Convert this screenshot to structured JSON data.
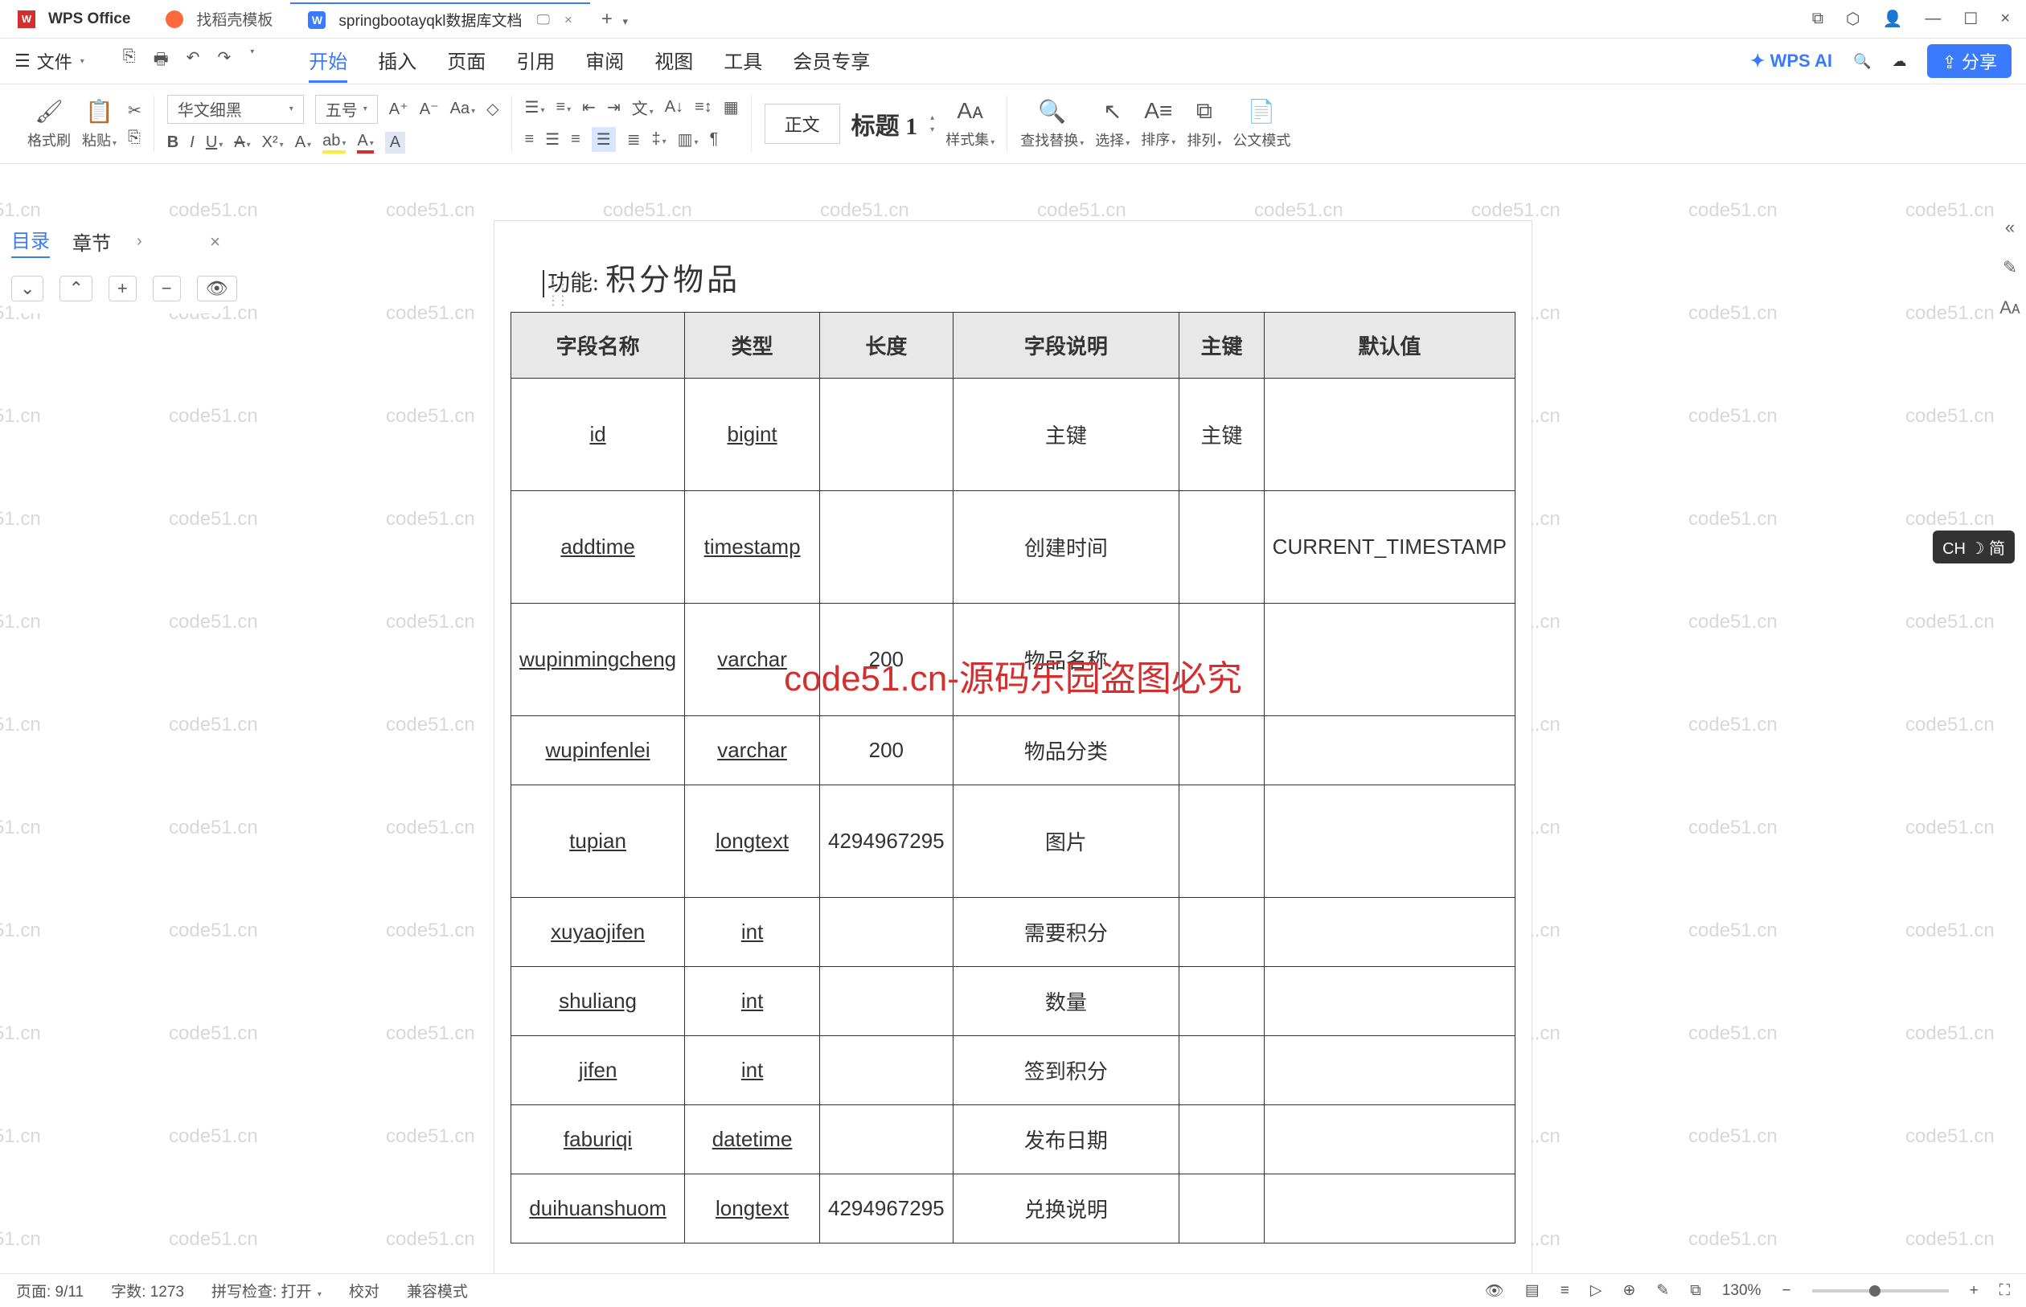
{
  "titlebar": {
    "app": "WPS Office",
    "tab2": "找稻壳模板",
    "tab3": "springbootayqkl数据库文档",
    "close": "×",
    "plus": "+",
    "caret": "▾"
  },
  "winctrl": {
    "min": "—",
    "max": "☐",
    "close": "×"
  },
  "quickaccess": [
    "⎘",
    "🖶",
    "⎌",
    "⎌"
  ],
  "fileitem": "文件",
  "menus": {
    "start": "开始",
    "insert": "插入",
    "page": "页面",
    "ref": "引用",
    "review": "审阅",
    "view": "视图",
    "tools": "工具",
    "member": "会员专享"
  },
  "ai": "WPS AI",
  "share": "分享",
  "toolbar": {
    "format_brush": "格式刷",
    "paste": "粘贴",
    "font_name": "华文细黑",
    "font_size": "五号",
    "style_body": "正文",
    "style_h1": "标题 1",
    "styles": "样式集",
    "findrep": "查找替换",
    "select": "选择",
    "sort": "排序",
    "sort2": "排列",
    "official": "公文模式"
  },
  "sidenav": {
    "tab1": "目录",
    "tab2": "章节"
  },
  "ime": "CH ☽ 简",
  "doc": {
    "func_label": "功能:",
    "func_value": "积分物品",
    "headers": {
      "c1": "字段名称",
      "c2": "类型",
      "c3": "长度",
      "c4": "字段说明",
      "c5": "主键",
      "c6": "默认值"
    },
    "rows": [
      {
        "c1": "id",
        "c2": "bigint",
        "c3": "",
        "c4": "主键",
        "c5": "主键",
        "c6": "",
        "tall": true
      },
      {
        "c1": "addtime",
        "c2": "timestamp",
        "c3": "",
        "c4": "创建时间",
        "c5": "",
        "c6": "CURRENT_TIMESTAMP",
        "tall": true
      },
      {
        "c1": "wupinmingcheng",
        "c2": "varchar",
        "c3": "200",
        "c4": "物品名称",
        "c5": "",
        "c6": "",
        "tall": true
      },
      {
        "c1": "wupinfenlei",
        "c2": "varchar",
        "c3": "200",
        "c4": "物品分类",
        "c5": "",
        "c6": ""
      },
      {
        "c1": "tupian",
        "c2": "longtext",
        "c3": "4294967295",
        "c4": "图片",
        "c5": "",
        "c6": "",
        "tall": true
      },
      {
        "c1": "xuyaojifen",
        "c2": "int",
        "c3": "",
        "c4": "需要积分",
        "c5": "",
        "c6": ""
      },
      {
        "c1": "shuliang",
        "c2": "int",
        "c3": "",
        "c4": "数量",
        "c5": "",
        "c6": ""
      },
      {
        "c1": "jifen",
        "c2": "int",
        "c3": "",
        "c4": "签到积分",
        "c5": "",
        "c6": ""
      },
      {
        "c1": "faburiqi",
        "c2": "datetime",
        "c3": "",
        "c4": "发布日期",
        "c5": "",
        "c6": ""
      },
      {
        "c1": "duihuanshuom",
        "c2": "longtext",
        "c3": "4294967295",
        "c4": "兑换说明",
        "c5": "",
        "c6": ""
      }
    ]
  },
  "watermark_text": "code51.cn",
  "center_watermark": "code51.cn-源码乐园盗图必究",
  "status": {
    "page": "页面: 9/11",
    "words": "字数: 1273",
    "spell": "拼写检查: 打开",
    "proof": "校对",
    "compat": "兼容模式",
    "zoom": "130%"
  }
}
